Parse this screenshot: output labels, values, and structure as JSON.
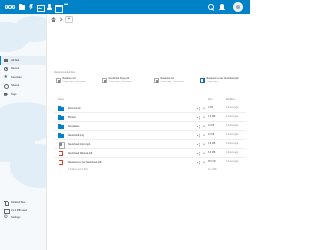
{
  "nav": {
    "all_files": "All files",
    "recent": "Recent",
    "favorites": "Favorites",
    "shares": "Shares",
    "tags": "Tags"
  },
  "sidebar_bottom": {
    "deleted_files": "Deleted files",
    "quota": "21.4 MB used",
    "settings": "Settings"
  },
  "recommendations": {
    "title": "Recommended files",
    "items": [
      {
        "name": "Readme.md",
        "info": "2 hours ago · Documents",
        "icon": "doc-icon"
      },
      {
        "name": "Nextcloud Flyer.pdf",
        "info": "2 hours ago · Documents",
        "icon": "doc-icon"
      },
      {
        "name": "Reasons.md",
        "info": "2 hours ago · Documents",
        "icon": "doc-icon"
      },
      {
        "name": "Reasons to use Nextcloud.pdf",
        "info": "2 hours ago",
        "icon": "blue-doc-icon"
      }
    ]
  },
  "table": {
    "header_name": "Name",
    "header_size": "Size",
    "header_modified": "Modified",
    "rows": [
      {
        "name": "Documents",
        "icon": "folder-icon",
        "size": "0 KB",
        "modified": "2 hours ago"
      },
      {
        "name": "Photos",
        "icon": "folder-icon",
        "size": "4.9 MB",
        "modified": "2 hours ago"
      },
      {
        "name": "Templates",
        "icon": "folder-icon",
        "size": "13 KB",
        "modified": "2 hours ago"
      },
      {
        "name": "Nextcloud.png",
        "icon": "folder-icon",
        "size": "43 KB",
        "modified": "2 hours ago"
      },
      {
        "name": "Nextcloud intro.mp4",
        "icon": "doc-icon",
        "size": "3.8 MB",
        "modified": "2 hours ago"
      },
      {
        "name": "Nextcloud Manual.pdf",
        "icon": "pdf-icon",
        "size": "6.8 MB",
        "modified": "2 hours ago"
      },
      {
        "name": "Reasons to use Nextcloud.pdf",
        "icon": "pdf-icon",
        "size": "957 KB",
        "modified": "2 hours ago"
      }
    ],
    "summary": "3 folders and 4 files",
    "summary_size": "21.4 MB"
  },
  "breadcrumb": {
    "add_label": "+"
  },
  "colors": {
    "brand": "#0082c9",
    "pdf": "#e3402b"
  }
}
